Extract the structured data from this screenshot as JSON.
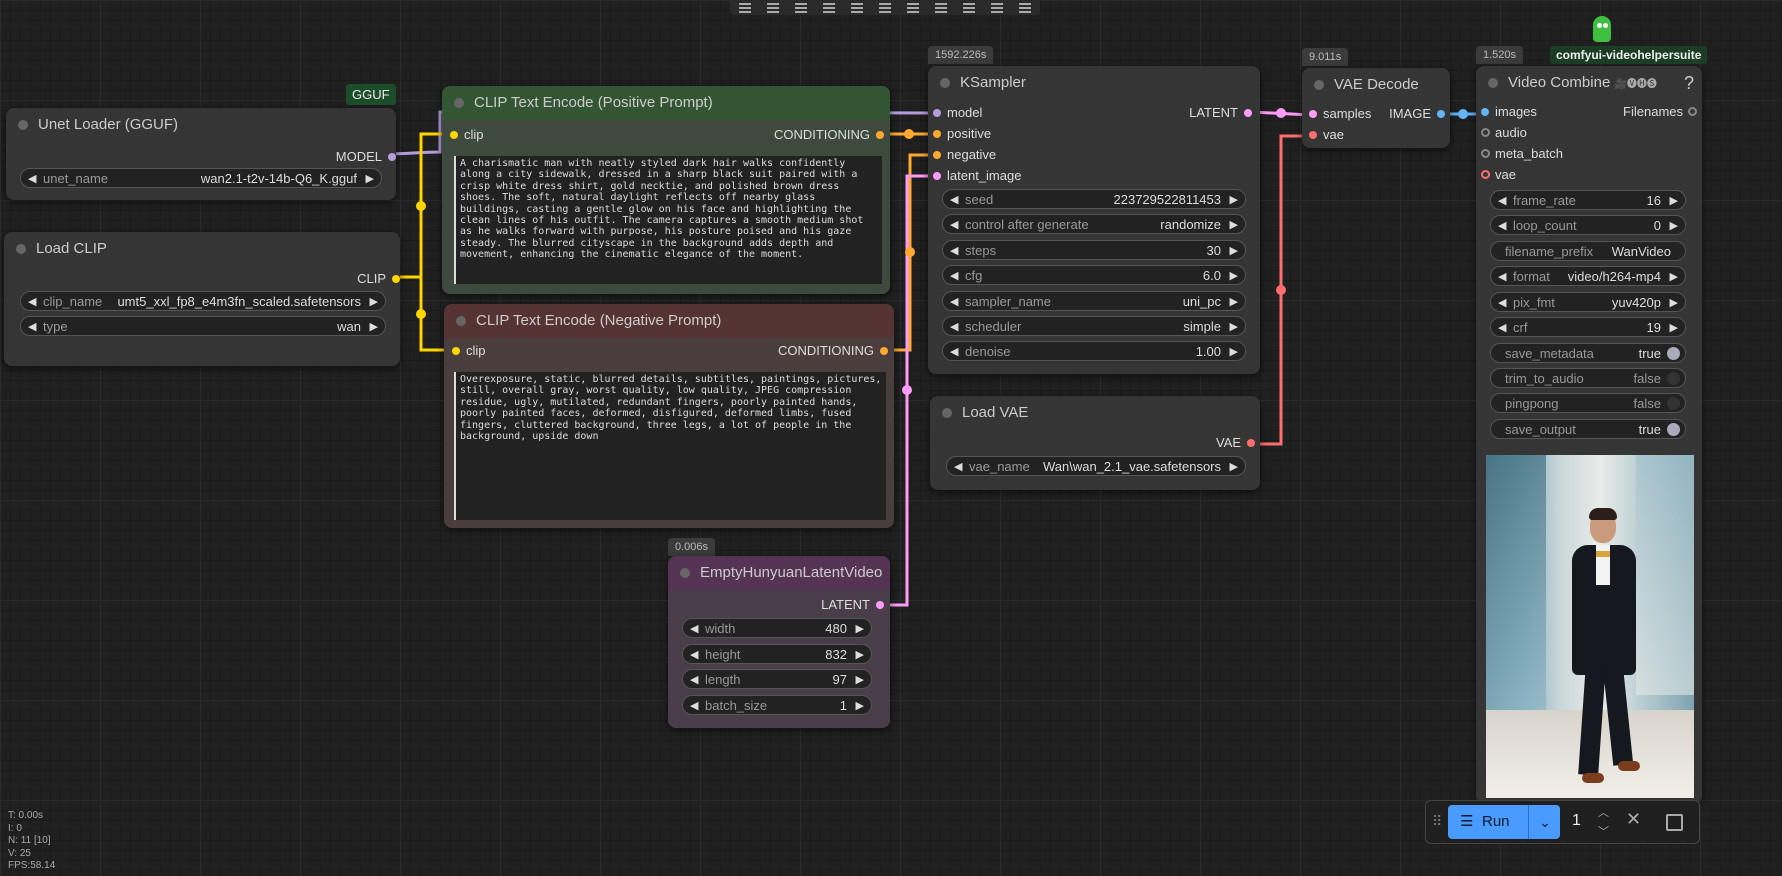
{
  "toolbar": {
    "icons": [
      "align-left-icon",
      "align-center-icon",
      "align-right-icon",
      "align-top-icon",
      "align-middle-icon",
      "align-bottom-icon",
      "distribute-horizontal-icon",
      "distribute-vertical-icon",
      "arrange-icon",
      "arrange-icon-2",
      "arrange-icon-3"
    ]
  },
  "gguf_badge": "GGUF",
  "unet": {
    "title": "Unet Loader (GGUF)",
    "output": "MODEL",
    "unet_name_label": "unet_name",
    "unet_name": "wan2.1-t2v-14b-Q6_K.gguf"
  },
  "clip_loader": {
    "title": "Load CLIP",
    "output": "CLIP",
    "clip_name_label": "clip_name",
    "clip_name": "umt5_xxl_fp8_e4m3fn_scaled.safetensors",
    "type_label": "type",
    "type": "wan"
  },
  "pos": {
    "title": "CLIP Text Encode (Positive Prompt)",
    "input": "clip",
    "output": "CONDITIONING",
    "text": "A charismatic man with neatly styled dark hair walks confidently along a city sidewalk, dressed in a sharp black suit paired with a crisp white dress shirt, gold necktie, and polished brown dress shoes. The soft, natural daylight reflects off nearby glass buildings, casting a gentle glow on his face and highlighting the clean lines of his outfit. The camera captures a smooth medium shot as he walks forward with purpose, his posture poised and his gaze steady. The blurred cityscape in the background adds depth and movement, enhancing the cinematic elegance of the moment."
  },
  "neg": {
    "title": "CLIP Text Encode (Negative Prompt)",
    "input": "clip",
    "output": "CONDITIONING",
    "text": "Overexposure, static, blurred details, subtitles, paintings, pictures, still, overall gray, worst quality, low quality, JPEG compression residue, ugly, mutilated, redundant fingers, poorly painted hands, poorly painted faces, deformed, disfigured, deformed limbs, fused fingers, cluttered background, three legs, a lot of people in the background, upside down"
  },
  "latent": {
    "time": "0.006s",
    "title": "EmptyHunyuanLatentVideo",
    "output": "LATENT",
    "widgets": [
      {
        "label": "width",
        "value": "480"
      },
      {
        "label": "height",
        "value": "832"
      },
      {
        "label": "length",
        "value": "97"
      },
      {
        "label": "batch_size",
        "value": "1"
      }
    ]
  },
  "ksampler": {
    "time": "1592.226s",
    "title": "KSampler",
    "inputs": [
      "model",
      "positive",
      "negative",
      "latent_image"
    ],
    "output": "LATENT",
    "widgets": [
      {
        "label": "seed",
        "value": "223729522811453"
      },
      {
        "label": "control after generate",
        "value": "randomize"
      },
      {
        "label": "steps",
        "value": "30"
      },
      {
        "label": "cfg",
        "value": "6.0"
      },
      {
        "label": "sampler_name",
        "value": "uni_pc"
      },
      {
        "label": "scheduler",
        "value": "simple"
      },
      {
        "label": "denoise",
        "value": "1.00"
      }
    ]
  },
  "loadvae": {
    "title": "Load VAE",
    "output": "VAE",
    "vae_name_label": "vae_name",
    "vae_name": "Wan\\wan_2.1_vae.safetensors"
  },
  "vaedecode": {
    "time": "9.011s",
    "title": "VAE Decode",
    "inputs": [
      "samples",
      "vae"
    ],
    "output": "IMAGE"
  },
  "videocombine": {
    "time": "1.520s",
    "badge": "comfyui-videohelpersuite",
    "title": "Video Combine",
    "title_suffix": "🎥🅥🅗🅢",
    "help": "?",
    "inputs": [
      "images",
      "audio",
      "meta_batch",
      "vae"
    ],
    "output": "Filenames",
    "widgets": [
      {
        "label": "frame_rate",
        "value": "16"
      },
      {
        "label": "loop_count",
        "value": "0"
      },
      {
        "label": "format",
        "value": "video/h264-mp4"
      },
      {
        "label": "pix_fmt",
        "value": "yuv420p"
      },
      {
        "label": "crf",
        "value": "19"
      }
    ],
    "filename_prefix_label": "filename_prefix",
    "filename_prefix": "WanVideo",
    "toggles": [
      {
        "label": "save_metadata",
        "value": "true"
      },
      {
        "label": "trim_to_audio",
        "value": "false"
      },
      {
        "label": "pingpong",
        "value": "false"
      },
      {
        "label": "save_output",
        "value": "true"
      }
    ]
  },
  "stats": [
    "T: 0.00s",
    "I: 0",
    "N: 11 [10]",
    "V: 25",
    "FPS:58.14"
  ],
  "runbar": {
    "run_label": "Run",
    "queue_count": "1"
  },
  "colors": {
    "model": "#b39ddb",
    "clip": "#ffd500",
    "conditioning": "#ffa931",
    "latent": "#ff9cf9",
    "vae": "#ff6e6e",
    "image": "#64b5f6",
    "positive_node": "#335533",
    "negative_node": "#553333",
    "latent_node": "#553355",
    "run": "#4a9bff"
  }
}
